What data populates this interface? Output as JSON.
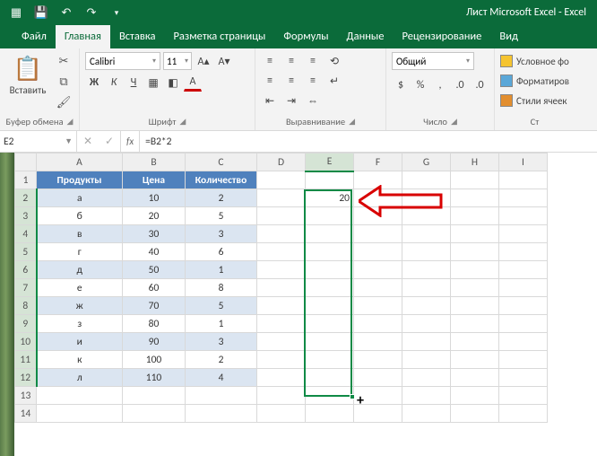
{
  "titlebar": {
    "title": "Лист Microsoft Excel  -  Excel"
  },
  "qat": {
    "save": "save-icon",
    "undo": "undo-icon",
    "redo": "redo-icon",
    "custom": "customize-icon"
  },
  "tabs": {
    "file": "Файл",
    "home": "Главная",
    "insert": "Вставка",
    "pagelayout": "Разметка страницы",
    "formulas": "Формулы",
    "data": "Данные",
    "review": "Рецензирование",
    "view": "Вид"
  },
  "ribbon": {
    "clipboard": {
      "paste": "Вставить",
      "label": "Буфер обмена"
    },
    "font": {
      "name": "Calibri",
      "size": "11",
      "bold": "Ж",
      "italic": "К",
      "underline": "Ч",
      "label": "Шрифт"
    },
    "alignment": {
      "label": "Выравнивание",
      "wrap": ""
    },
    "number": {
      "format": "Общий",
      "label": "Число"
    },
    "styles": {
      "cond": "Условное фо",
      "fmt": "Форматиров",
      "cell": "Стили ячеек"
    }
  },
  "formulabar": {
    "namebox": "E2",
    "formula": "=B2*2"
  },
  "columns": [
    "A",
    "B",
    "C",
    "D",
    "E",
    "F",
    "G",
    "H",
    "I"
  ],
  "rows_visible": 14,
  "data_table": {
    "headers": [
      "Продукты",
      "Цена",
      "Количество"
    ],
    "rows": [
      [
        "а",
        "10",
        "2"
      ],
      [
        "б",
        "20",
        "5"
      ],
      [
        "в",
        "30",
        "3"
      ],
      [
        "г",
        "40",
        "6"
      ],
      [
        "д",
        "50",
        "1"
      ],
      [
        "е",
        "60",
        "8"
      ],
      [
        "ж",
        "70",
        "5"
      ],
      [
        "з",
        "80",
        "1"
      ],
      [
        "и",
        "90",
        "3"
      ],
      [
        "к",
        "100",
        "2"
      ],
      [
        "л",
        "110",
        "4"
      ]
    ]
  },
  "e_cell_value": "20",
  "selection": {
    "cell": "E2",
    "range": "E2:E12"
  }
}
